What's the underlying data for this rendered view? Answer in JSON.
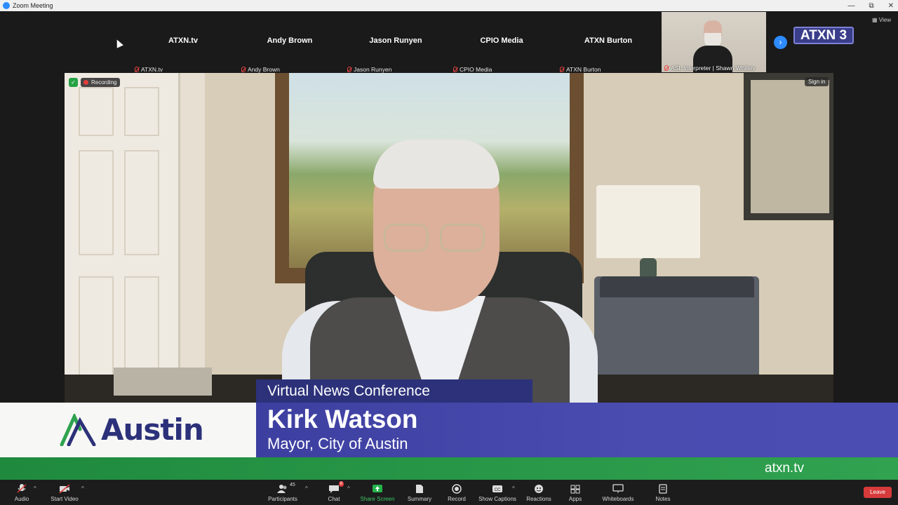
{
  "window": {
    "title": "Zoom Meeting"
  },
  "window_controls": {
    "minimize": "—",
    "restore": "⧉",
    "close": "✕"
  },
  "view_label": "View",
  "participants_strip": [
    {
      "name": "ATXN.tv",
      "label": "ATXN.tv"
    },
    {
      "name": "Andy Brown",
      "label": "Andy Brown"
    },
    {
      "name": "Jason Runyen",
      "label": "Jason Runyen"
    },
    {
      "name": "CPIO Media",
      "label": "CPIO Media"
    },
    {
      "name": "ATXN Burton",
      "label": "ATXN Burton"
    }
  ],
  "interpreter_tile": {
    "label": "ASL Interpreter | Shawn Whitley"
  },
  "next_arrow": "›",
  "channel_logo": "ATXN 3",
  "recording": {
    "label": "Recording"
  },
  "sign_in": "Sign in",
  "lower_third": {
    "event": "Virtual News Conference",
    "name": "Kirk Watson",
    "title": "Mayor, City of Austin",
    "org_logo_text": "Austin",
    "url": "atxn.tv"
  },
  "toolbar": {
    "audio": "Audio",
    "start_video": "Start Video",
    "participants": "Participants",
    "participants_count": "45",
    "chat": "Chat",
    "chat_badge": "8",
    "share_screen": "Share Screen",
    "summary": "Summary",
    "record": "Record",
    "show_captions": "Show Captions",
    "reactions": "Reactions",
    "apps": "Apps",
    "whiteboards": "Whiteboards",
    "notes": "Notes",
    "leave": "Leave"
  },
  "colors": {
    "zoom_blue": "#2d8cff",
    "lower_third_blue": "#3d3fa0",
    "austin_green": "#1f8a3e",
    "leave_red": "#d63a3a"
  }
}
